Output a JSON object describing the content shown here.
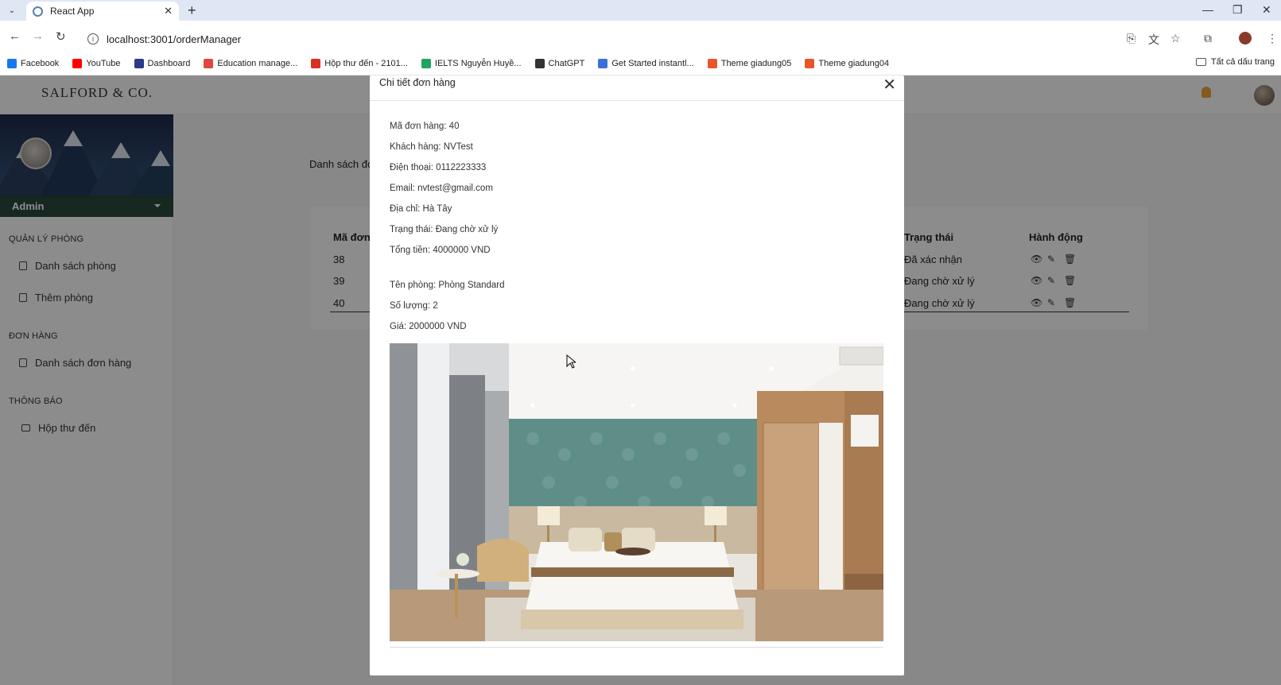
{
  "browser": {
    "tab_title": "React App",
    "url": "localhost:3001/orderManager",
    "bookmarks": [
      {
        "label": "Facebook",
        "color": "#1877f2"
      },
      {
        "label": "YouTube",
        "color": "#ff0000"
      },
      {
        "label": "Dashboard",
        "color": "#2b3a8c"
      },
      {
        "label": "Education manage...",
        "color": "#e0483e"
      },
      {
        "label": "Hộp thư đến - 2101...",
        "color": "#d93025"
      },
      {
        "label": "IELTS Nguyễn Huyề...",
        "color": "#1fa463"
      },
      {
        "label": "ChatGPT",
        "color": "#333333"
      },
      {
        "label": "Get Started instantl...",
        "color": "#3b6fd6"
      },
      {
        "label": "Theme giadung05",
        "color": "#e8552b"
      },
      {
        "label": "Theme giadung04",
        "color": "#e8552b"
      }
    ],
    "all_bookmarks": "Tất cả dấu trang"
  },
  "app": {
    "logo": "SALFORD & CO.",
    "logo_small": "WORDMARK",
    "user_name": "Admin",
    "sidebar": {
      "sections": [
        {
          "title": "QUẢN LÝ PHÒNG",
          "items": [
            "Danh sách phòng",
            "Thêm phòng"
          ]
        },
        {
          "title": "ĐƠN HÀNG",
          "items": [
            "Danh sách đơn hàng"
          ]
        },
        {
          "title": "THÔNG BÁO",
          "items": [
            "Hộp thư đến"
          ]
        }
      ]
    },
    "page_title": "Danh sách đơ",
    "table": {
      "headers": [
        "Mã đơn",
        "Trạng thái",
        "Hành động"
      ],
      "rows": [
        {
          "id": "38",
          "status": "Đã xác nhận"
        },
        {
          "id": "39",
          "status": "Đang chờ xử lý"
        },
        {
          "id": "40",
          "status": "Đang chờ xử lý"
        }
      ]
    }
  },
  "modal": {
    "title": "Chi tiết đơn hàng",
    "fields": [
      "Mã đơn hàng: 40",
      "Khách hàng: NVTest",
      "Điện thoại: 0112223333",
      "Email: nvtest@gmail.com",
      "Địa chỉ: Hà Tây",
      "Trạng thái: Đang chờ xử lý",
      "Tổng tiền: 4000000 VND"
    ],
    "item_fields": [
      "Tên phòng: Phòng Standard",
      "Số lượng: 2",
      "Giá: 2000000 VND"
    ]
  }
}
